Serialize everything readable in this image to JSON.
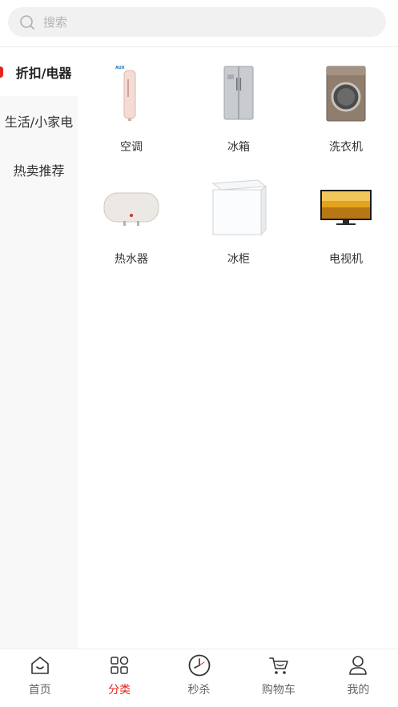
{
  "search": {
    "placeholder": "搜索"
  },
  "sidebar": {
    "items": [
      {
        "label": "折扣/电器",
        "active": true
      },
      {
        "label": "生活/小家电",
        "active": false
      },
      {
        "label": "热卖推荐",
        "active": false
      }
    ]
  },
  "products": [
    {
      "name": "空调",
      "icon": "air-conditioner"
    },
    {
      "name": "冰箱",
      "icon": "refrigerator"
    },
    {
      "name": "洗衣机",
      "icon": "washing-machine"
    },
    {
      "name": "热水器",
      "icon": "water-heater"
    },
    {
      "name": "冰柜",
      "icon": "chest-freezer"
    },
    {
      "name": "电视机",
      "icon": "television"
    }
  ],
  "tabbar": {
    "items": [
      {
        "label": "首页",
        "icon": "home-icon",
        "active": false
      },
      {
        "label": "分类",
        "icon": "category-icon",
        "active": true
      },
      {
        "label": "秒杀",
        "icon": "clock-icon",
        "active": false
      },
      {
        "label": "购物车",
        "icon": "cart-icon",
        "active": false
      },
      {
        "label": "我的",
        "icon": "user-icon",
        "active": false
      }
    ]
  },
  "colors": {
    "accent": "#e5261f",
    "sidebar_bg": "#f8f8f8",
    "search_bg": "#f1f1f1"
  }
}
